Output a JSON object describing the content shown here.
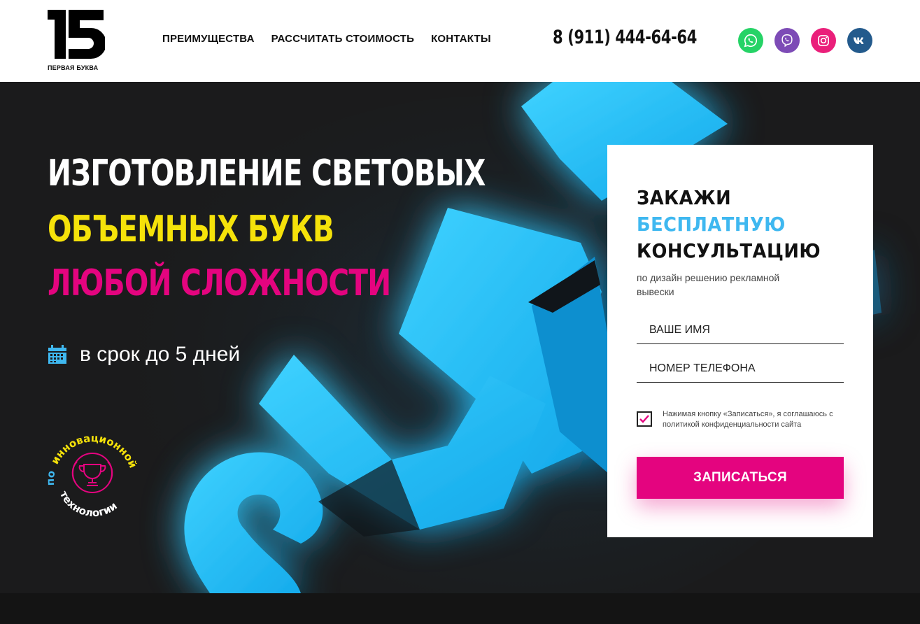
{
  "brand": {
    "logo_number": "15",
    "logo_caption": "ПЕРВАЯ БУКВА"
  },
  "nav": {
    "items": [
      {
        "label": "ПРЕИМУЩЕСТВА"
      },
      {
        "label": "РАССЧИТАТЬ СТОИМОСТЬ"
      },
      {
        "label": "КОНТАКТЫ"
      }
    ]
  },
  "header": {
    "phone": "8 (911) 444-64-64"
  },
  "socials": [
    {
      "icon": "whatsapp-icon",
      "color": "#25d366"
    },
    {
      "icon": "viber-icon",
      "color": "#7d4bb6"
    },
    {
      "icon": "instagram-icon",
      "color": "#ea1f7a"
    },
    {
      "icon": "vk-icon",
      "color": "#235a8c"
    }
  ],
  "hero": {
    "title_line1": "ИЗГОТОВЛЕНИЕ СВЕТОВЫХ",
    "title_line2": "ОБЪЕМНЫХ БУКВ",
    "title_line3": "ЛЮБОЙ СЛОЖНОСТИ",
    "deadline_text": "в срок до 5 дней",
    "badge_text_prefix": "по",
    "badge_text_highlight": "инновационной",
    "badge_text_suffix": "технологии",
    "colors": {
      "yellow": "#f5e20a",
      "magenta": "#e4047f",
      "blue": "#3fb8f0"
    }
  },
  "form": {
    "title_line1": "ЗАКАЖИ",
    "title_line2": "БЕСПЛАТНУЮ",
    "title_line3": "КОНСУЛЬТАЦИЮ",
    "subtitle": "по дизайн решению рекламной вывески",
    "name_placeholder": "ВАШЕ ИМЯ",
    "phone_placeholder": "НОМЕР ТЕЛЕФОНА",
    "consent_text": "Нажимая кнопку «Записаться», я соглашаюсь с политикой конфиденциальности сайта",
    "consent_checked": true,
    "submit_label": "ЗАПИСАТЬСЯ"
  }
}
